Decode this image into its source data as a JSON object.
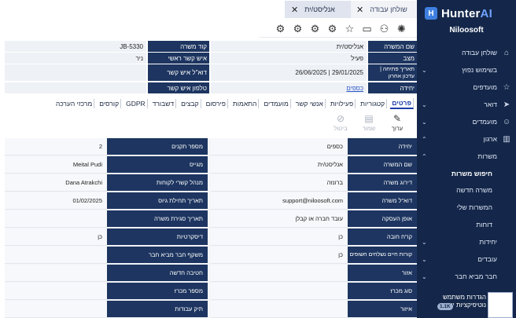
{
  "window_tabs": [
    {
      "label": "שולחן עבודה",
      "close": "✕"
    },
    {
      "label": "אנליסט/ית",
      "close": "✕"
    }
  ],
  "toolbar_icons": [
    "lightbulb-icon",
    "user-settings-icon",
    "folder-icon",
    "star-icon",
    "gear-icon-1",
    "gear-icon-2",
    "gear-icon-3",
    "gear-icon-4"
  ],
  "sidebar": {
    "logo_text": "Hunter",
    "logo_accent": "AI",
    "company": "Niloosoft",
    "items": [
      {
        "label": "שולחן עבודה",
        "icon": "home-icon"
      },
      {
        "label": "בשימוש נפוץ",
        "icon": "",
        "chevron": true
      },
      {
        "label": "מועדפים",
        "icon": "star-icon"
      },
      {
        "label": "דואר",
        "icon": "send-icon",
        "chevron": true
      },
      {
        "label": "מועמדים",
        "icon": "person-icon",
        "chevron": true
      },
      {
        "label": "ארגון",
        "icon": "building-icon",
        "chevron": true
      },
      {
        "label": "משרות",
        "icon": "",
        "chevron": true
      },
      {
        "label": "חיפוש משרות",
        "icon": "",
        "sub": true,
        "active": true
      },
      {
        "label": "משרה חדשה",
        "icon": "",
        "sub": true
      },
      {
        "label": "המשרות שלי",
        "icon": "",
        "sub": true
      },
      {
        "label": "דוחות",
        "icon": "",
        "sub": true
      },
      {
        "label": "יחידות",
        "icon": "",
        "chevron": true
      },
      {
        "label": "עובדים",
        "icon": "",
        "chevron": true
      },
      {
        "label": "חבר מביא חבר",
        "icon": "",
        "chevron": true
      }
    ],
    "footer_label": "הגדרות משתמש נוטיפיקציות יציאה",
    "footer_badge": "1.1K"
  },
  "info": {
    "job_name_label": "שם המשרה",
    "job_name_value": "אנליסט/ית",
    "status_label": "מצב",
    "status_value": "פעיל",
    "dates_label": "תאריך פתיחה | עדכון אחרון",
    "dates_value": "26/06/2025 | 29/01/2025",
    "unit_label": "יחידה",
    "unit_value": "כספים",
    "code_label": "קוד משרה",
    "code_value": "JB-5330",
    "contact_label": "איש קשר ראשי",
    "contact_value": "ניר",
    "email_label": "דוא\"ל איש קשר",
    "email_value": "",
    "phone_label": "טלפון איש קשר",
    "phone_value": ""
  },
  "section_tabs": [
    "פרטים",
    "קטגוריות",
    "פעילויות",
    "אנשי קשר",
    "מועמדים",
    "התאמות",
    "פירסום",
    "קבצים",
    "דשבורד",
    "GDPR",
    "קורסים",
    "מרכזי הערכה"
  ],
  "actions": {
    "edit": "ערוך",
    "save": "שמור",
    "cancel": "ביטול"
  },
  "details": {
    "right": [
      {
        "label": "יחידה",
        "value": "כספים"
      },
      {
        "label": "שם המשרה",
        "value": "אנליסט/ית"
      },
      {
        "label": "דירוג משרה",
        "value": "ברונזה"
      },
      {
        "label": "דוא\"ל משרה",
        "value": "support@niloosoft.com"
      },
      {
        "label": "אופן העסקה",
        "value": "עובד חברה או קבלן"
      },
      {
        "label": "קו\"ח חובה",
        "value": "כן"
      },
      {
        "label": "קורות חיים נשלחים חשופים",
        "value": "כן"
      },
      {
        "label": "אזור",
        "value": ""
      },
      {
        "label": "סוג מכרז",
        "value": ""
      },
      {
        "label": "איזור",
        "value": ""
      }
    ],
    "left": [
      {
        "label": "מספר תקנים",
        "value": "2"
      },
      {
        "label": "מגייס",
        "value": "Meital Pudi"
      },
      {
        "label": "מנהל קשרי לקוחות",
        "value": "Dana Atrakchi"
      },
      {
        "label": "תאריך תחילת גיוס",
        "value": "01/02/2025"
      },
      {
        "label": "תאריך סגירת משרה",
        "value": ""
      },
      {
        "label": "דיסקרטיות",
        "value": "כן"
      },
      {
        "label": "משקף חבר מביא חבר",
        "value": ""
      },
      {
        "label": "חטיבה חדשה",
        "value": ""
      },
      {
        "label": "מספר מכרז",
        "value": ""
      },
      {
        "label": "תיק עבודות",
        "value": ""
      }
    ]
  },
  "colors": {
    "sidebar": "#14274a",
    "label_bg": "#1d3560",
    "accent": "#1d3ea8"
  }
}
